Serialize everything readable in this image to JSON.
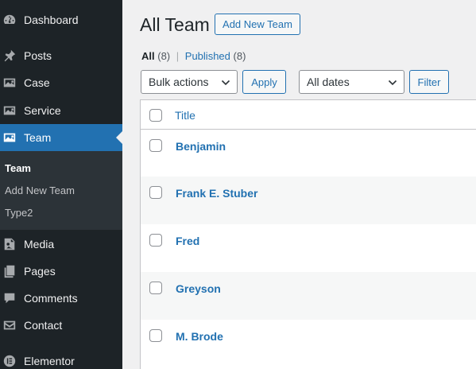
{
  "sidebar": {
    "items": [
      {
        "label": "Dashboard",
        "icon": "dashboard-icon"
      },
      {
        "label": "Posts",
        "icon": "pin-icon"
      },
      {
        "label": "Case",
        "icon": "image-icon"
      },
      {
        "label": "Service",
        "icon": "image-icon"
      },
      {
        "label": "Team",
        "icon": "image-icon",
        "active": true
      },
      {
        "label": "Media",
        "icon": "media-icon"
      },
      {
        "label": "Pages",
        "icon": "pages-icon"
      },
      {
        "label": "Comments",
        "icon": "comment-icon"
      },
      {
        "label": "Contact",
        "icon": "mail-icon"
      },
      {
        "label": "Elementor",
        "icon": "elementor-icon"
      }
    ],
    "submenu": [
      {
        "label": "Team",
        "current": true
      },
      {
        "label": "Add New Team"
      },
      {
        "label": "Type2"
      }
    ]
  },
  "header": {
    "title": "All Team",
    "add_new_label": "Add New Team"
  },
  "views": {
    "all_label": "All",
    "all_count": "(8)",
    "separator": "|",
    "published_label": "Published",
    "published_count": "(8)"
  },
  "filters": {
    "bulk_actions": "Bulk actions",
    "apply_label": "Apply",
    "dates": "All dates",
    "filter_label": "Filter"
  },
  "table": {
    "column_title": "Title",
    "rows": [
      "Benjamin",
      "Frank E. Stuber",
      "Fred",
      "Greyson",
      "M. Brode"
    ]
  },
  "colors": {
    "sidebar_bg": "#1d2327",
    "accent": "#2271b1",
    "submenu_bg": "#2c3338"
  }
}
